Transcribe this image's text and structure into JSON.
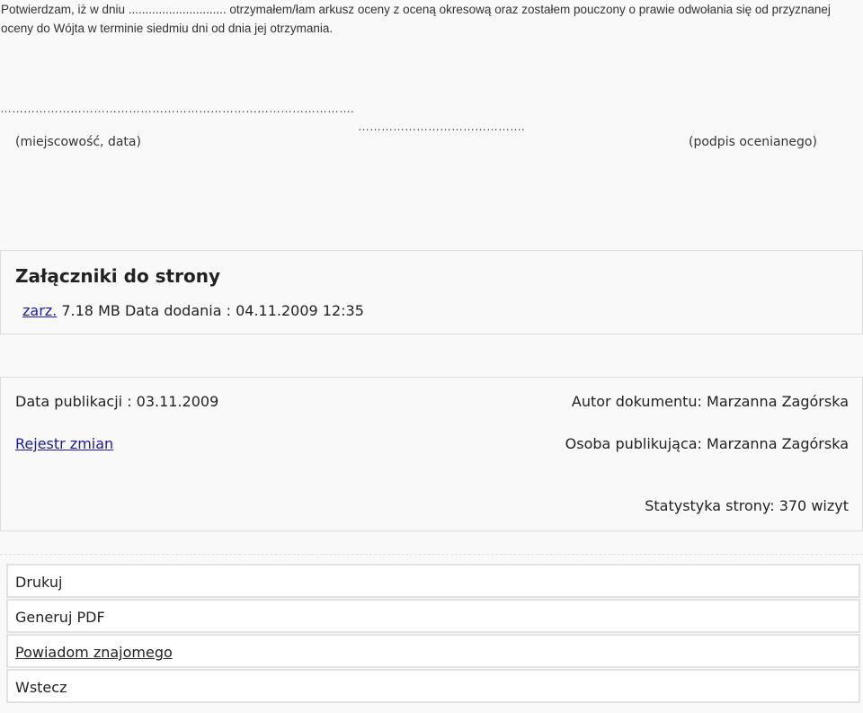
{
  "declaration": {
    "text": "Potwierdzam, iż w dniu ............................. otrzymałem/łam arkusz oceny z oceną okresową oraz zostałem pouczony o prawie odwołania się od przyznanej oceny do Wójta w terminie siedmiu dni od dnia jej otrzymania.",
    "place_date_dots": "……………………………………………………………………………….",
    "place_date_label": "(miejscowość, data)",
    "signature_dots": "…………………………………….",
    "signature_label": "(podpis ocenianego)"
  },
  "attachments": {
    "heading": "Załączniki do strony",
    "items": [
      {
        "link": "zarz.",
        "info": "7.18 MB Data dodania : 04.11.2009 12:35"
      }
    ]
  },
  "meta": {
    "publication_date": "Data publikacji : 03.11.2009",
    "changes_link": "Rejestr zmian",
    "author": "Autor dokumentu: Marzanna Zagórska",
    "publisher": "Osoba publikująca: Marzanna Zagórska",
    "stats": "Statystyka strony: 370 wizyt"
  },
  "actions": {
    "print": "Drukuj",
    "pdf": "Generuj PDF",
    "notify": "Powiadom znajomego",
    "back": "Wstecz"
  },
  "colors": {
    "background": "#f9f9f9",
    "link": "#1a1aa6",
    "border": "#dcdcdc"
  }
}
